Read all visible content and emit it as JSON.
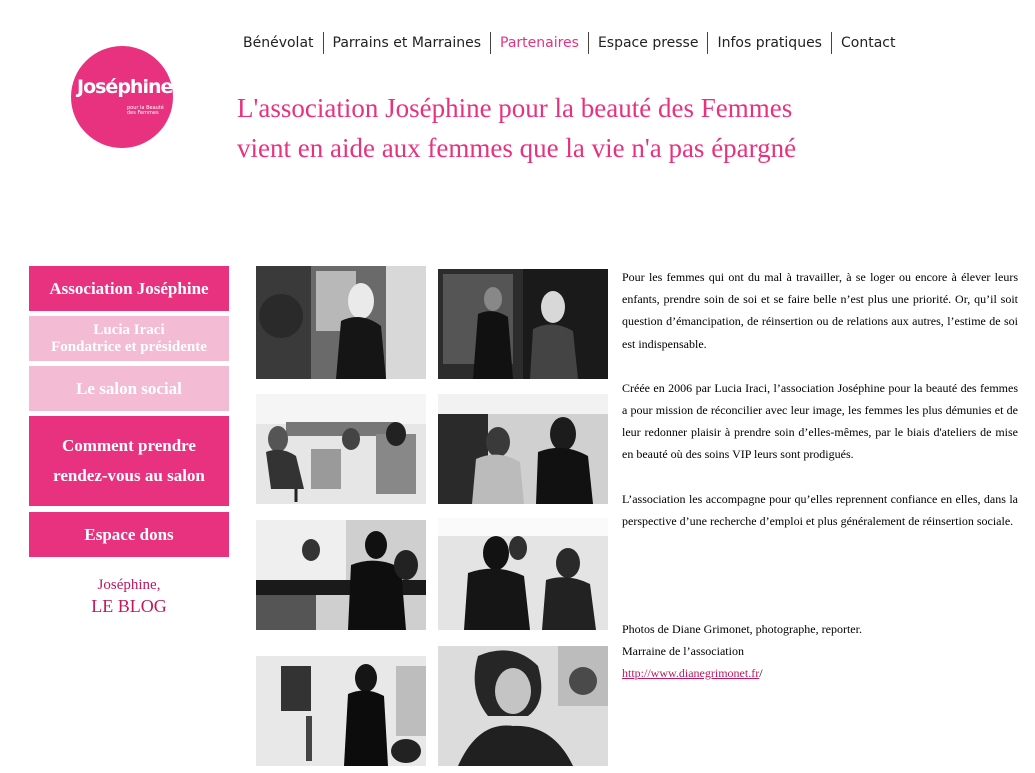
{
  "logo": {
    "wordmark": "Joséphine",
    "tagline": "pour la Beauté des Femmes"
  },
  "nav": {
    "items": [
      {
        "label": "Bénévolat"
      },
      {
        "label": "Parrains et Marraines"
      },
      {
        "label": "Partenaires",
        "active": true
      },
      {
        "label": "Espace presse"
      },
      {
        "label": "Infos pratiques"
      },
      {
        "label": "Contact"
      }
    ]
  },
  "headline": {
    "line1": "L'association Joséphine pour la beauté des Femmes",
    "line2": "vient en aide aux femmes que la vie n'a pas épargné"
  },
  "sidebar": {
    "items": [
      {
        "label": "Association Joséphine"
      },
      {
        "line1": "Lucia Iraci",
        "line2": "Fondatrice et présidente"
      },
      {
        "label": "Le salon social"
      },
      {
        "line1": "Comment prendre",
        "line2": "rendez-vous au salon"
      },
      {
        "label": "Espace dons"
      }
    ],
    "blog": {
      "line1": "Joséphine,",
      "line2": "LE BLOG"
    }
  },
  "article": {
    "p1": "Pour les femmes qui ont du mal à travailler, à se loger ou encore à élever leurs enfants, prendre soin de soi et se faire belle n’est plus une priorité. Or, qu’il soit question d’émancipation, de réinsertion ou de relations aux autres, l’estime de soi est indispensable.",
    "p2": "Créée en 2006 par Lucia Iraci, l’association Joséphine pour la beauté des femmes a pour mission de réconcilier avec leur image, les femmes les plus démunies et de leur redonner plaisir à prendre soin d’elles-mêmes, par le biais d'ateliers de mise en beauté où des soins VIP leurs sont prodigués.",
    "p3": "L’association les accompagne pour qu’elles reprennent confiance en elles, dans la perspective d’une recherche d’emploi et plus généralement de réinsertion sociale."
  },
  "credits": {
    "line1": "Photos de Diane Grimonet, photographe, reporter.",
    "line2": "Marraine de l’association",
    "link": "http://www.dianegrimonet.fr",
    "link_suffix": "/"
  },
  "colors": {
    "brand_pink": "#e8327f",
    "light_pink": "#f4bcd4",
    "blog_pink": "#c0175f"
  }
}
